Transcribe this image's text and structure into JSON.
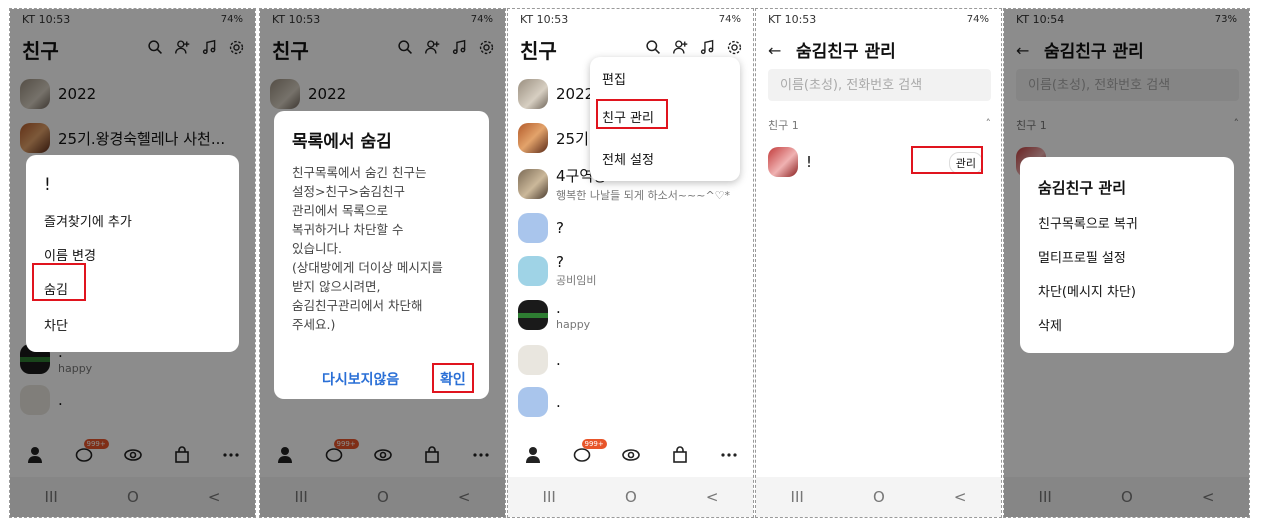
{
  "common": {
    "status_battery_1": "§74%▮",
    "status_battery_2": "73%",
    "tab_badge": "999+",
    "nav_recent": "III",
    "nav_home": "O",
    "nav_back": "<"
  },
  "panel1": {
    "time": "KT 10:53",
    "signal": "74%",
    "title": "친구",
    "friends": [
      {
        "name": "2022"
      },
      {
        "name": "25기.왕경숙헬레나 사천..."
      }
    ],
    "behind": {
      "name": ".",
      "sub": "happy",
      "name2": "."
    },
    "menu": {
      "items": [
        "!",
        "즐겨찾기에 추가",
        "이름 변경",
        "숨김",
        "차단"
      ]
    }
  },
  "panel2": {
    "time": "KT 10:53",
    "signal": "74%",
    "title": "친구",
    "friend_top": "2022",
    "dialog": {
      "title": "목록에서 숨김",
      "body": "친구목록에서 숨긴 친구는\n설정>친구>숨김친구\n관리에서 목록으로\n복귀하거나 차단할 수\n있습니다.\n(상대방에게 더이상 메시지를\n받지 않으시려면,\n숨김친구관리에서 차단해\n주세요.)",
      "dont_show": "다시보지않음",
      "confirm": "확인"
    }
  },
  "panel3": {
    "time": "KT 10:53",
    "signal": "74%",
    "title": "친구",
    "friends": [
      {
        "name": "2022",
        "sub": ""
      },
      {
        "name": "25기",
        "sub": ""
      },
      {
        "name": "4구역장",
        "sub": "행복한 나날들 되게 하소서~~~^♡*"
      },
      {
        "name": "?",
        "sub": ""
      },
      {
        "name": "?",
        "sub": "공비임비"
      },
      {
        "name": ".",
        "sub": "happy"
      },
      {
        "name": ".",
        "sub": ""
      },
      {
        "name": ".",
        "sub": ""
      }
    ],
    "dropdown": [
      "편집",
      "친구 관리",
      "전체 설정"
    ]
  },
  "panel4": {
    "time": "KT 10:53",
    "signal": "74%",
    "title": "숨김친구 관리",
    "search_placeholder": "이름(초성), 전화번호 검색",
    "section": "친구 1",
    "friend_name": "!",
    "manage_label": "관리"
  },
  "panel5": {
    "time": "KT 10:54",
    "signal": "73%",
    "title": "숨김친구 관리",
    "search_placeholder": "이름(초성), 전화번호 검색",
    "section": "친구 1",
    "menu": {
      "title": "숨김친구 관리",
      "items": [
        "친구목록으로 복귀",
        "멀티프로필 설정",
        "차단(메시지 차단)",
        "삭제"
      ]
    }
  }
}
